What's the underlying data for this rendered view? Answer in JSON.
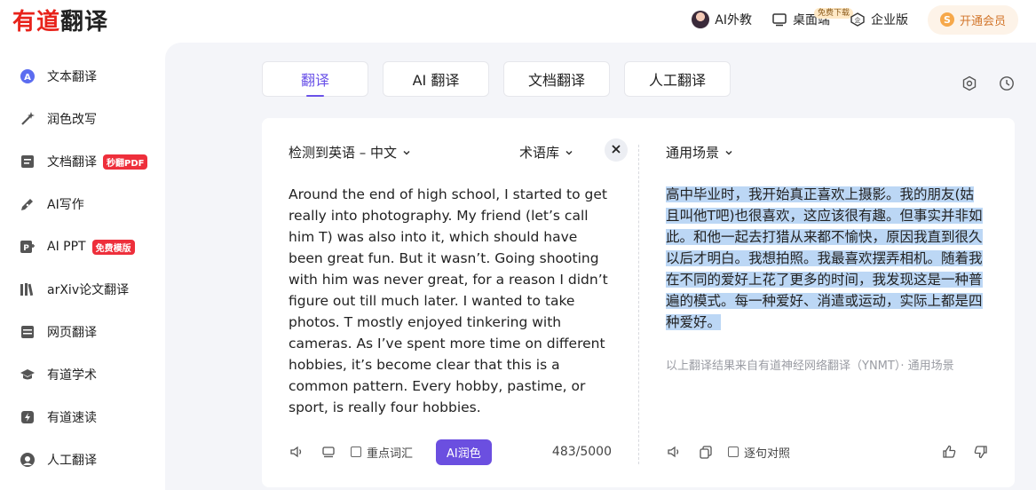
{
  "header": {
    "logo_part1": "有道",
    "logo_part2": "翻译",
    "nav": [
      {
        "label": "AI外教",
        "icon": "avatar"
      },
      {
        "label": "桌面端",
        "icon": "monitor-icon",
        "badge": "免费下载"
      },
      {
        "label": "企业版",
        "icon": "enterprise-icon"
      }
    ],
    "vip_label": "开通会员",
    "vip_coin": "S"
  },
  "sidebar": {
    "items": [
      {
        "label": "文本翻译",
        "icon": "text-translate-icon"
      },
      {
        "label": "润色改写",
        "icon": "magic-wand-icon"
      },
      {
        "label": "文档翻译",
        "icon": "document-icon",
        "tag": "秒翻PDF"
      },
      {
        "label": "AI写作",
        "icon": "pen-icon"
      },
      {
        "label": "AI PPT",
        "icon": "ppt-icon",
        "tag": "免费模版"
      },
      {
        "label": "arXiv论文翻译",
        "icon": "books-icon"
      },
      {
        "label": "网页翻译",
        "icon": "webpage-icon"
      },
      {
        "label": "有道学术",
        "icon": "graduation-cap-icon"
      },
      {
        "label": "有道速读",
        "icon": "lightning-icon"
      },
      {
        "label": "人工翻译",
        "icon": "human-icon"
      }
    ]
  },
  "tabs": [
    {
      "label": "翻译"
    },
    {
      "label": "AI 翻译"
    },
    {
      "label": "文档翻译"
    },
    {
      "label": "人工翻译"
    }
  ],
  "source": {
    "lang_label": "检测到英语 – 中文",
    "term_label": "术语库",
    "text": "Around the end of high school, I started to get really into photography.   My friend (let’s call him T) was also into it, which should have been great fun.   But it wasn’t.   Going shooting with him was never great, for a reason I didn’t figure out till much later.   I wanted to take photos.   T mostly enjoyed tinkering with cameras.   As I’ve spent more time on different hobbies, it’s become clear that this is a common pattern.   Every hobby, pastime, or sport, is really four hobbies.",
    "keyword_label": "重点词汇",
    "ai_button": "AI润色",
    "count": "483/5000"
  },
  "target": {
    "scene_label": "通用场景",
    "text": "高中毕业时，我开始真正喜欢上摄影。我的朋友(姑且叫他T吧)也很喜欢，这应该很有趣。但事实并非如此。和他一起去打猎从来都不愉快，原因我直到很久以后才明白。我想拍照。我最喜欢摆弄相机。随着我在不同的爱好上花了更多的时间，我发现这是一种普遍的模式。每一种爱好、消遣或运动，实际上都是四种爱好。",
    "note": "以上翻译结果来自有道神经网络翻译（YNMT）· 通用场景",
    "compare_label": "逐句对照"
  }
}
